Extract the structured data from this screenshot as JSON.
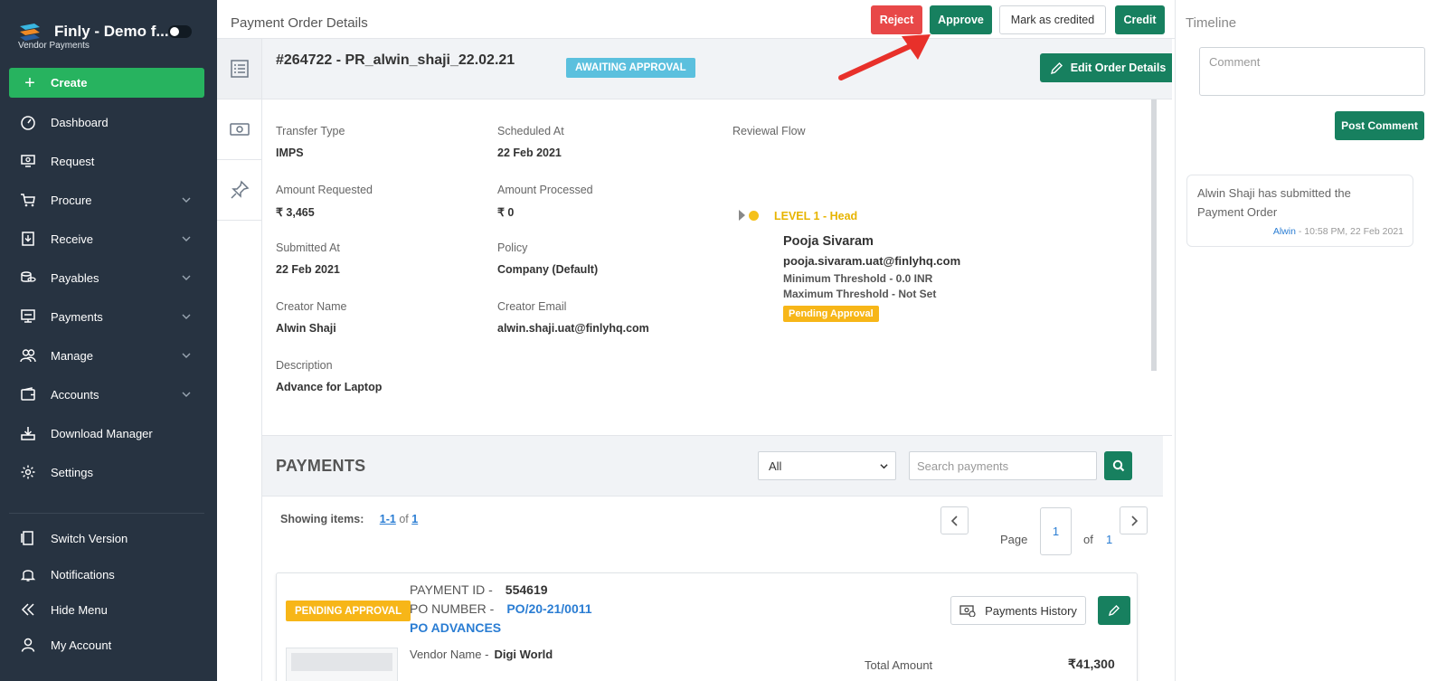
{
  "brand": {
    "title": "Finly - Demo f...",
    "subtitle": "Vendor Payments"
  },
  "sidebar": {
    "create_label": "Create",
    "items": [
      {
        "label": "Dashboard",
        "icon": "dashboard-icon",
        "has_chevron": false
      },
      {
        "label": "Request",
        "icon": "request-icon",
        "has_chevron": false
      },
      {
        "label": "Procure",
        "icon": "cart-icon",
        "has_chevron": true
      },
      {
        "label": "Receive",
        "icon": "receive-icon",
        "has_chevron": true
      },
      {
        "label": "Payables",
        "icon": "coins-icon",
        "has_chevron": true
      },
      {
        "label": "Payments",
        "icon": "payments-icon",
        "has_chevron": true
      },
      {
        "label": "Manage",
        "icon": "users-icon",
        "has_chevron": true
      },
      {
        "label": "Accounts",
        "icon": "wallet-icon",
        "has_chevron": true
      },
      {
        "label": "Download Manager",
        "icon": "download-icon",
        "has_chevron": false
      },
      {
        "label": "Settings",
        "icon": "gear-icon",
        "has_chevron": false
      }
    ],
    "bottom_items": [
      {
        "label": "Switch Version",
        "icon": "switch-icon"
      },
      {
        "label": "Notifications",
        "icon": "bell-icon"
      },
      {
        "label": "Hide Menu",
        "icon": "double-chevron-left-icon"
      },
      {
        "label": "My Account",
        "icon": "user-icon"
      }
    ]
  },
  "header": {
    "title": "Payment Order Details",
    "reject_label": "Reject",
    "approve_label": "Approve",
    "mark_credited_label": "Mark as credited",
    "credit_label": "Credit"
  },
  "order": {
    "title": "#264722  -  PR_alwin_shaji_22.02.21",
    "status": "AWAITING APPROVAL",
    "edit_label": "Edit Order Details"
  },
  "details": {
    "transfer_type": {
      "label": "Transfer Type",
      "value": "IMPS"
    },
    "scheduled_at": {
      "label": "Scheduled At",
      "value": "22 Feb 2021"
    },
    "amount_requested": {
      "label": "Amount Requested",
      "value": "₹ 3,465"
    },
    "amount_processed": {
      "label": "Amount Processed",
      "value": "₹ 0"
    },
    "submitted_at": {
      "label": "Submitted At",
      "value": "22 Feb 2021"
    },
    "policy": {
      "label": "Policy",
      "value": "Company (Default)"
    },
    "creator_name": {
      "label": "Creator Name",
      "value": "Alwin Shaji"
    },
    "creator_email": {
      "label": "Creator Email",
      "value": "alwin.shaji.uat@finlyhq.com"
    },
    "description": {
      "label": "Description",
      "value": "Advance for Laptop"
    }
  },
  "review": {
    "label": "Reviewal Flow",
    "level": "LEVEL 1  -   Head",
    "reviewer_name": "Pooja Sivaram",
    "reviewer_email": "pooja.sivaram.uat@finlyhq.com",
    "min_threshold": "Minimum Threshold -   0.0 INR",
    "max_threshold": "Maximum Threshold -   Not Set",
    "status": "Pending Approval"
  },
  "payments": {
    "title": "PAYMENTS",
    "filter_value": "All",
    "search_placeholder": "Search payments",
    "showing_label": "Showing items:",
    "showing_range": "1-1",
    "showing_of": "of",
    "showing_total": "1",
    "page_label": "Page",
    "page_current": "1",
    "page_of": "of",
    "page_total": "1"
  },
  "payment_card": {
    "status": "PENDING APPROVAL",
    "payment_id_label": "PAYMENT ID  -",
    "payment_id": "554619",
    "po_number_label": "PO NUMBER  -",
    "po_number": "PO/20-21/0011",
    "po_type": "PO ADVANCES",
    "vendor_label": "Vendor Name  -",
    "vendor_name": "Digi World",
    "history_label": "Payments History",
    "total_label": "Total Amount",
    "total_value": "₹41,300"
  },
  "timeline": {
    "title": "Timeline",
    "comment_placeholder": "Comment",
    "post_label": "Post Comment",
    "entries": [
      {
        "text": "Alwin Shaji has submitted the Payment Order",
        "author": "Alwin",
        "time": " - 10:58 PM, 22 Feb 2021"
      }
    ]
  },
  "colors": {
    "sidebar_bg": "#273341",
    "primary_green": "#17805f",
    "create_green": "#27b35f",
    "reject_red": "#e84848",
    "awaiting_blue": "#5bc0de",
    "pending_amber": "#f7b618",
    "link_blue": "#2a7dd3",
    "annotation_red": "#e8302a"
  }
}
